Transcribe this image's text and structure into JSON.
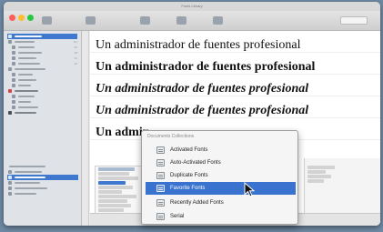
{
  "window": {
    "title": "Fonts Library"
  },
  "samples": [
    {
      "text": "Un administrador de fuentes profesional",
      "style": "regular"
    },
    {
      "text": "Un administrador de fuentes profesional",
      "style": "bold"
    },
    {
      "text": "Un administrador de fuentes profesional",
      "style": "bold-italic"
    },
    {
      "text": "Un administrador de fuentes profesional",
      "style": "bold-italic"
    },
    {
      "text": "Un admin",
      "style": "bold"
    }
  ],
  "popup": {
    "header": "Documents Collections",
    "items": [
      {
        "label": "Activated Fonts",
        "icon": "folder-icon",
        "selected": false
      },
      {
        "label": "Auto-Activated Fonts",
        "icon": "folder-icon",
        "selected": false
      },
      {
        "label": "Duplicate Fonts",
        "icon": "folder-icon",
        "selected": false
      },
      {
        "label": "Favorite Fonts",
        "icon": "folder-icon",
        "selected": true
      },
      {
        "label": "Recently Added Fonts",
        "icon": "folder-icon",
        "selected": false
      },
      {
        "label": "Serial",
        "icon": "folder-icon",
        "selected": false
      }
    ]
  },
  "colors": {
    "selection": "#3a72cf",
    "window_bg": "#ececec",
    "desktop": "#6f89a4"
  }
}
